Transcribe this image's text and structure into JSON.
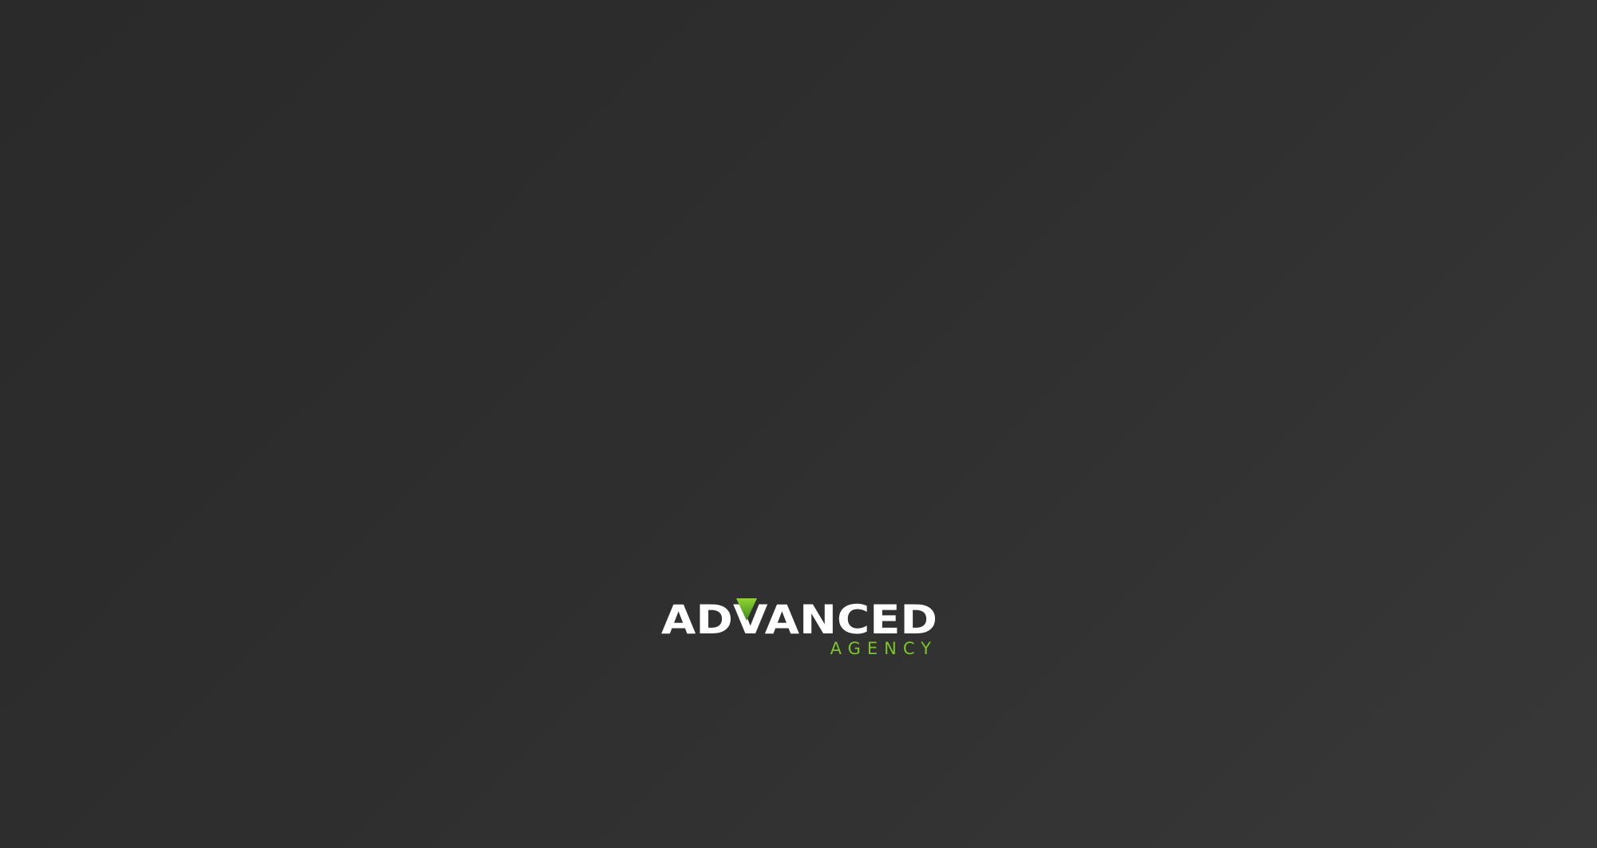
{
  "logo": {
    "wordmark": "ADVANCED",
    "tagline": "AGENCY",
    "wordmark_color": "#ffffff",
    "accent_color": "#7cc42a",
    "accent_color_dark": "#3d8a1e",
    "accent_icon": "triangle-down-icon"
  },
  "colors": {
    "background": "#2e2e2e"
  }
}
